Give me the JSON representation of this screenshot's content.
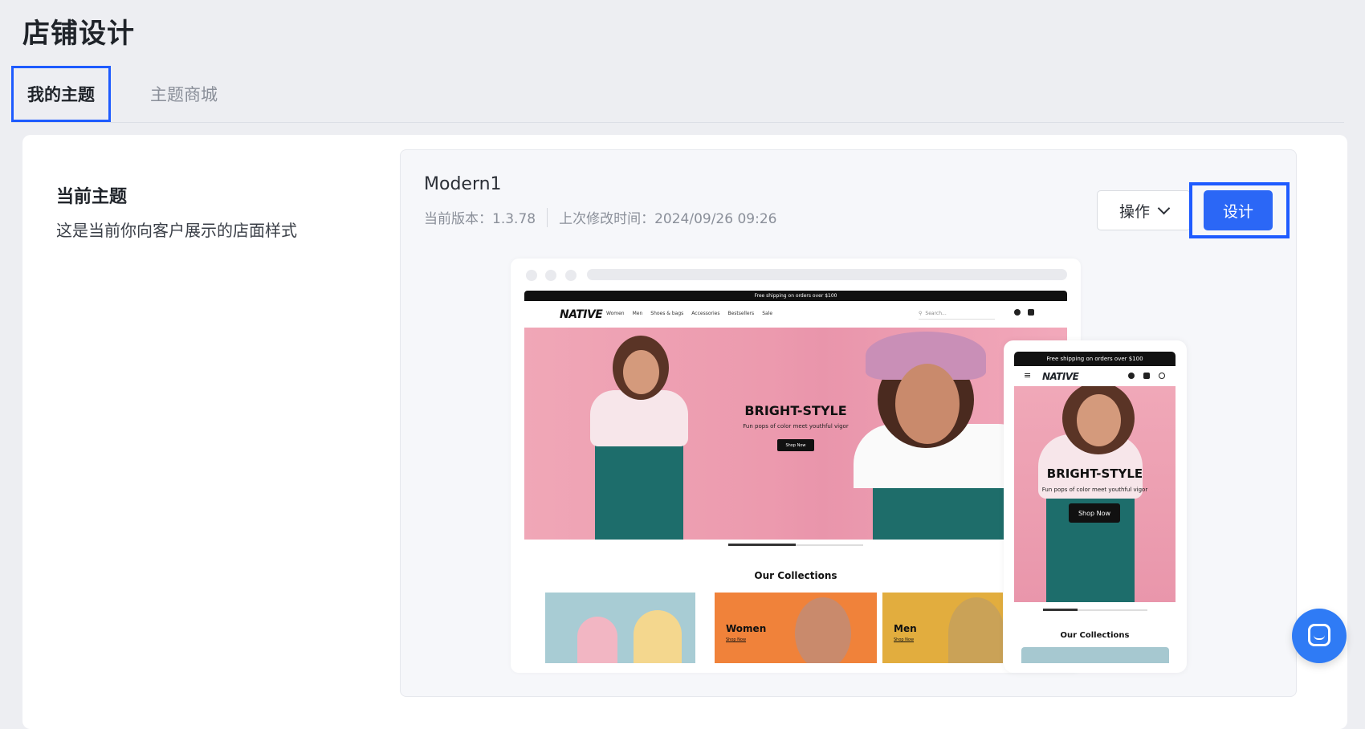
{
  "page": {
    "title": "店铺设计"
  },
  "tabs": [
    {
      "label": "我的主题",
      "active": true
    },
    {
      "label": "主题商城",
      "active": false
    }
  ],
  "current_theme": {
    "section_title": "当前主题",
    "section_desc": "这是当前你向客户展示的店面样式",
    "name": "Modern1",
    "version": "当前版本：1.3.78",
    "modified": "上次修改时间：2024/09/26 09:26",
    "ops_label": "操作",
    "design_label": "设计"
  },
  "preview": {
    "shipping_banner": "Free shipping on orders over $100",
    "logo": "NATIVE",
    "nav_links": [
      "Women",
      "Men",
      "Shoes & bags",
      "Accessories",
      "Bestsellers",
      "Sale"
    ],
    "search_placeholder": "Search...",
    "hero_title": "BRIGHT-STYLE",
    "hero_subtitle": "Fun pops of color meet youthful vigor",
    "hero_button": "Shop Now",
    "collections_title": "Our Collections",
    "collections": [
      {
        "label": "",
        "sub": "",
        "color": "#a8ccd4"
      },
      {
        "label": "Women",
        "sub": "Shop Now",
        "color": "#f0823a"
      },
      {
        "label": "Men",
        "sub": "Shop Now",
        "color": "#e2ad3e"
      }
    ],
    "menu_glyph": "≡",
    "slider_progress": 0.5
  },
  "colors": {
    "accent": "#2b67f6",
    "highlight": "#1e5bff",
    "chat": "#2f7bf5"
  },
  "icons": {
    "dropdown": "chevron-down-icon",
    "chat": "chat-icon"
  }
}
